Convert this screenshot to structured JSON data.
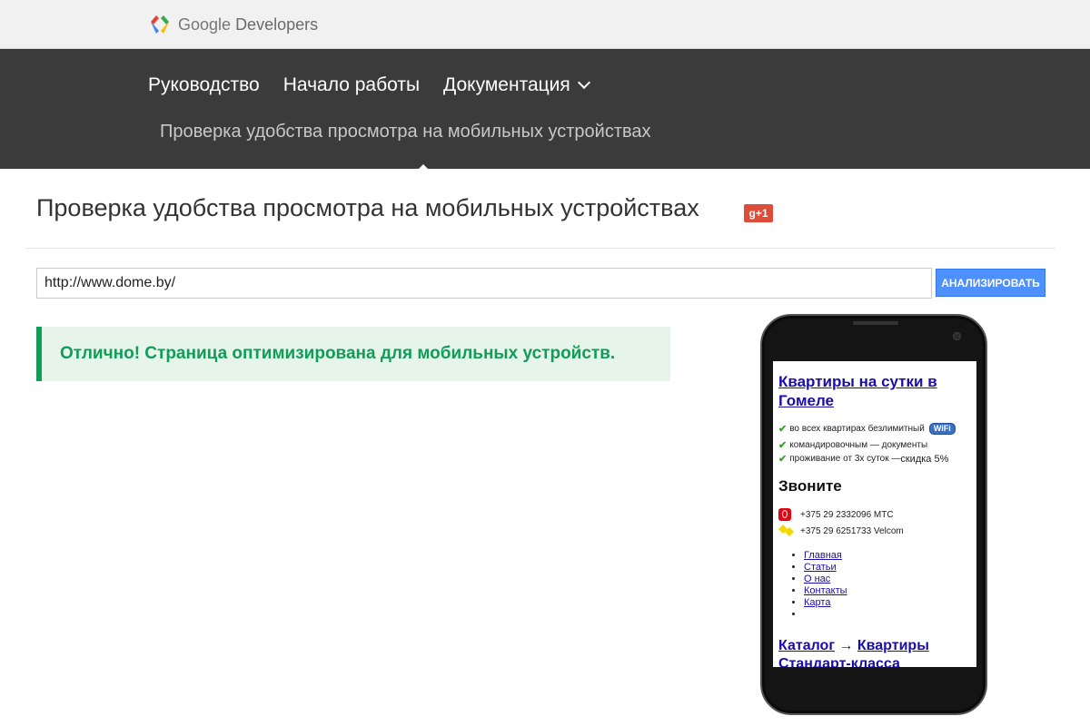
{
  "brand": {
    "name_part1": "Google",
    "name_part2": "Developers",
    "icon": "google-developers-logo-icon"
  },
  "nav": {
    "items": [
      {
        "label": "Руководство"
      },
      {
        "label": "Начало работы"
      },
      {
        "label": "Документация",
        "icon": "chevron-down-icon"
      }
    ],
    "sub_item": "Проверка удобства просмотра на мобильных устройствах"
  },
  "page": {
    "title": "Проверка удобства просмотра на мобильных устройствах",
    "gplus_label": "g+1"
  },
  "analyzer": {
    "url_value": "http://www.dome.by/",
    "button_label": "АНАЛИЗИРОВАТЬ"
  },
  "result": {
    "message": "Отлично! Страница оптимизирована для мобильных устройств."
  },
  "preview": {
    "site_title": "Квартиры на сутки в Гомеле",
    "features": [
      {
        "text": "во всех квартирах безлимитный",
        "badge": "WiFi"
      },
      {
        "text": "командировочным — документы"
      },
      {
        "text_part1": "проживание от 3х суток — ",
        "text_part2": "скидка 5%"
      }
    ],
    "call_heading": "Звоните",
    "phones": [
      {
        "number": "+375 29 2332096 МТС",
        "operator_icon": "mts-icon"
      },
      {
        "number": "+375 29 6251733 Velcom",
        "operator_icon": "velcom-icon"
      }
    ],
    "menu": [
      "Главная",
      "Статьи",
      "О нас",
      "Контакты",
      "Карта"
    ],
    "breadcrumb": {
      "first": "Каталог",
      "arrow": "→",
      "second": "Квартиры Стандарт-класса"
    }
  },
  "colors": {
    "nav_bg": "#3b3b3b",
    "accent_blue": "#4d90fe",
    "success_green": "#0f9d58",
    "gplus_red": "#dd4b39"
  }
}
